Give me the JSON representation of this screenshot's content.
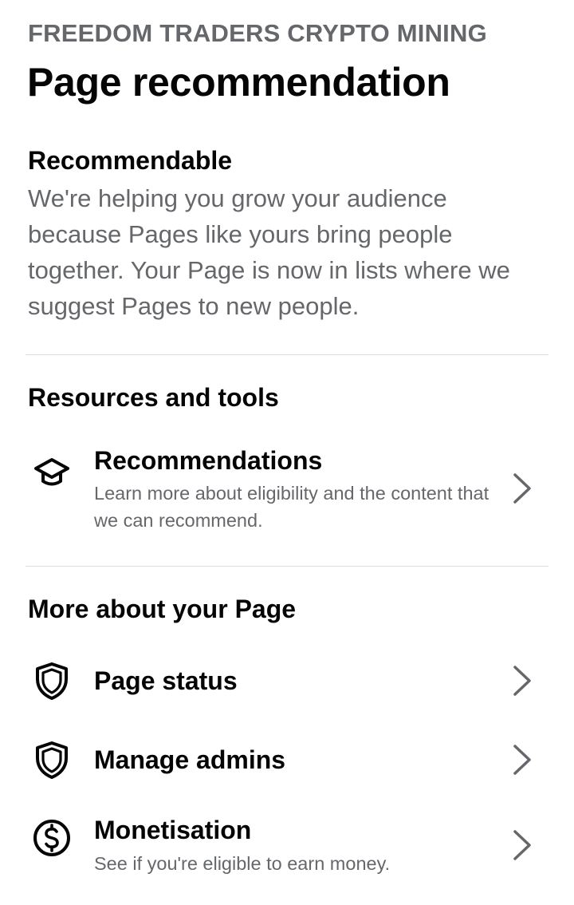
{
  "header": {
    "page_name": "FREEDOM TRADERS CRYPTO MINING",
    "title": "Page recommendation"
  },
  "status": {
    "heading": "Recommendable",
    "body": "We're helping you grow your audience because Pages like yours bring people together. Your Page is now in lists where we suggest Pages to new people."
  },
  "resources": {
    "heading": "Resources and tools",
    "items": [
      {
        "title": "Recommendations",
        "subtitle": "Learn more about eligibility and the content that we can recommend.",
        "icon": "graduation-cap-icon"
      }
    ]
  },
  "more": {
    "heading": "More about your Page",
    "items": [
      {
        "title": "Page status",
        "subtitle": "",
        "icon": "shield-icon"
      },
      {
        "title": "Manage admins",
        "subtitle": "",
        "icon": "shield-icon"
      },
      {
        "title": "Monetisation",
        "subtitle": "See if you're eligible to earn money.",
        "icon": "dollar-circle-icon"
      }
    ]
  },
  "colors": {
    "primary_text": "#050505",
    "secondary_text": "#65676b",
    "divider": "#dadde1",
    "background": "#ffffff"
  }
}
